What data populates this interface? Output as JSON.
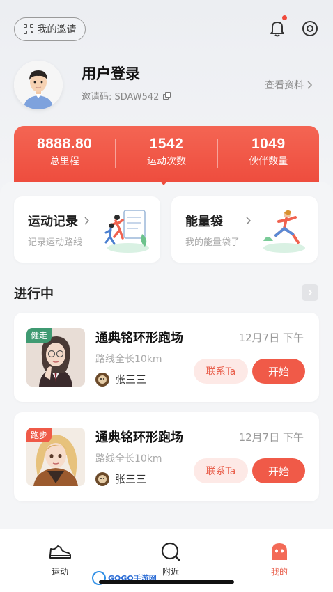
{
  "header": {
    "invite_label": "我的邀请",
    "username": "用户登录",
    "invite_code": "邀请码: SDAW542",
    "profile_link": "查看资料"
  },
  "stats": [
    {
      "value": "8888.80",
      "label": "总里程"
    },
    {
      "value": "1542",
      "label": "运动次数"
    },
    {
      "value": "1049",
      "label": "伙伴数量"
    }
  ],
  "cards": [
    {
      "title": "运动记录",
      "subtitle": "记录运动路线"
    },
    {
      "title": "能量袋",
      "subtitle": "我的能量袋子"
    }
  ],
  "in_progress": {
    "title": "进行中",
    "items": [
      {
        "tag": "健走",
        "tag_color": "#3f9a72",
        "name": "通典铭环形跑场",
        "date": "12月7日  下午",
        "length": "路线全长10km",
        "user": "张三三",
        "contact": "联系Ta",
        "start": "开始"
      },
      {
        "tag": "跑步",
        "tag_color": "#ef5a48",
        "name": "通典铭环形跑场",
        "date": "12月7日  下午",
        "length": "路线全长10km",
        "user": "张三三",
        "contact": "联系Ta",
        "start": "开始"
      }
    ]
  },
  "tabbar": [
    {
      "label": "运动",
      "icon": "shoe-icon"
    },
    {
      "label": "附近",
      "icon": "search-icon"
    },
    {
      "label": "我的",
      "icon": "profile-icon",
      "active": true
    }
  ],
  "watermark": "GOGO手游网",
  "colors": {
    "accent": "#f05a48",
    "accent_light": "#fde9e6",
    "tag_walk": "#3f9a72"
  }
}
